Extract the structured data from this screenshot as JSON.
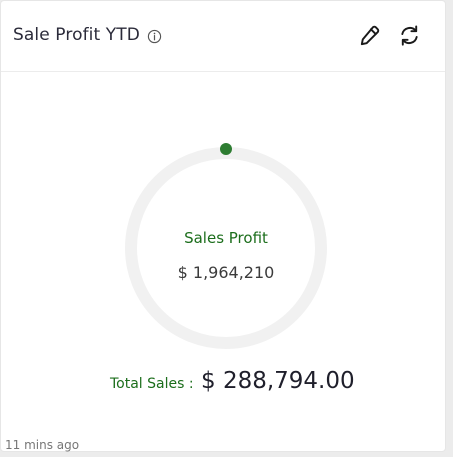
{
  "header": {
    "title": "Sale Profit YTD",
    "icons": [
      "info-icon",
      "pencil-edit-icon",
      "refresh-icon"
    ]
  },
  "gauge": {
    "label": "Sales Profit",
    "value": "$ 1,964,210",
    "track_color": "#f1f1f1",
    "marker_color": "#2e7d32"
  },
  "total": {
    "label": "Total Sales :",
    "value": "$ 288,794.00"
  },
  "footer": {
    "timestamp": "11 mins ago"
  },
  "colors": {
    "accent_green": "#1c6e1c",
    "title_text": "#2b2b3a"
  }
}
